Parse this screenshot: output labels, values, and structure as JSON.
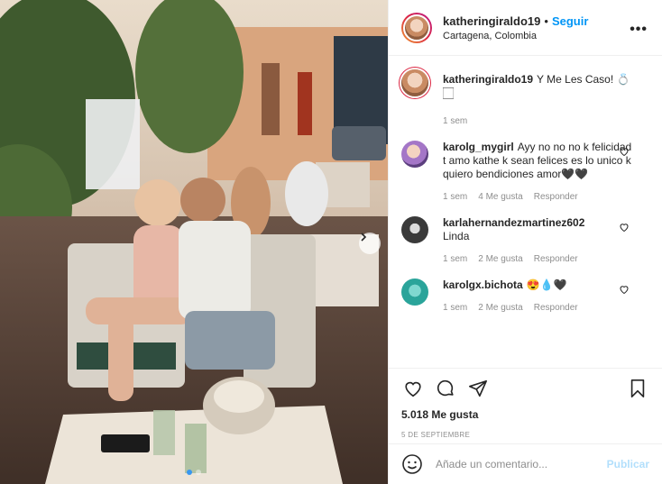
{
  "header": {
    "username": "katheringiraldo19",
    "separator": "•",
    "follow_label": "Seguir",
    "location": "Cartagena, Colombia",
    "more_label": "•••"
  },
  "caption": {
    "username": "katheringiraldo19",
    "text": "Y Me Les Caso! 💍🏻",
    "time": "1 sem"
  },
  "comments": [
    {
      "username": "karolg_mygirl",
      "text": "Ayy no no no k felicidad t amo kathe k sean felices es lo unico k quiero bendiciones amor🖤🖤",
      "time": "1 sem",
      "likes": "4 Me gusta",
      "reply": "Responder"
    },
    {
      "username": "karlahernandezmartinez602",
      "text": "Linda",
      "time": "1 sem",
      "likes": "2 Me gusta",
      "reply": "Responder"
    },
    {
      "username": "karolgx.bichota",
      "text": "😍💧🖤",
      "time": "1 sem",
      "likes": "2 Me gusta",
      "reply": "Responder"
    }
  ],
  "post": {
    "likes_count": "5.018 Me gusta",
    "date": "5 DE SEPTIEMBRE"
  },
  "add_comment": {
    "placeholder": "Añade un comentario...",
    "publish_label": "Publicar"
  },
  "icons": {
    "like": "heart-icon",
    "comment": "comment-icon",
    "share": "paper-plane-icon",
    "save": "bookmark-icon",
    "emoji": "smiley-icon",
    "next": "chevron-right-icon"
  },
  "colors": {
    "follow": "#0095f6",
    "publish_disabled": "#b2dffc",
    "muted_text": "#8e8e8e",
    "text": "#262626",
    "border": "#efefef"
  }
}
